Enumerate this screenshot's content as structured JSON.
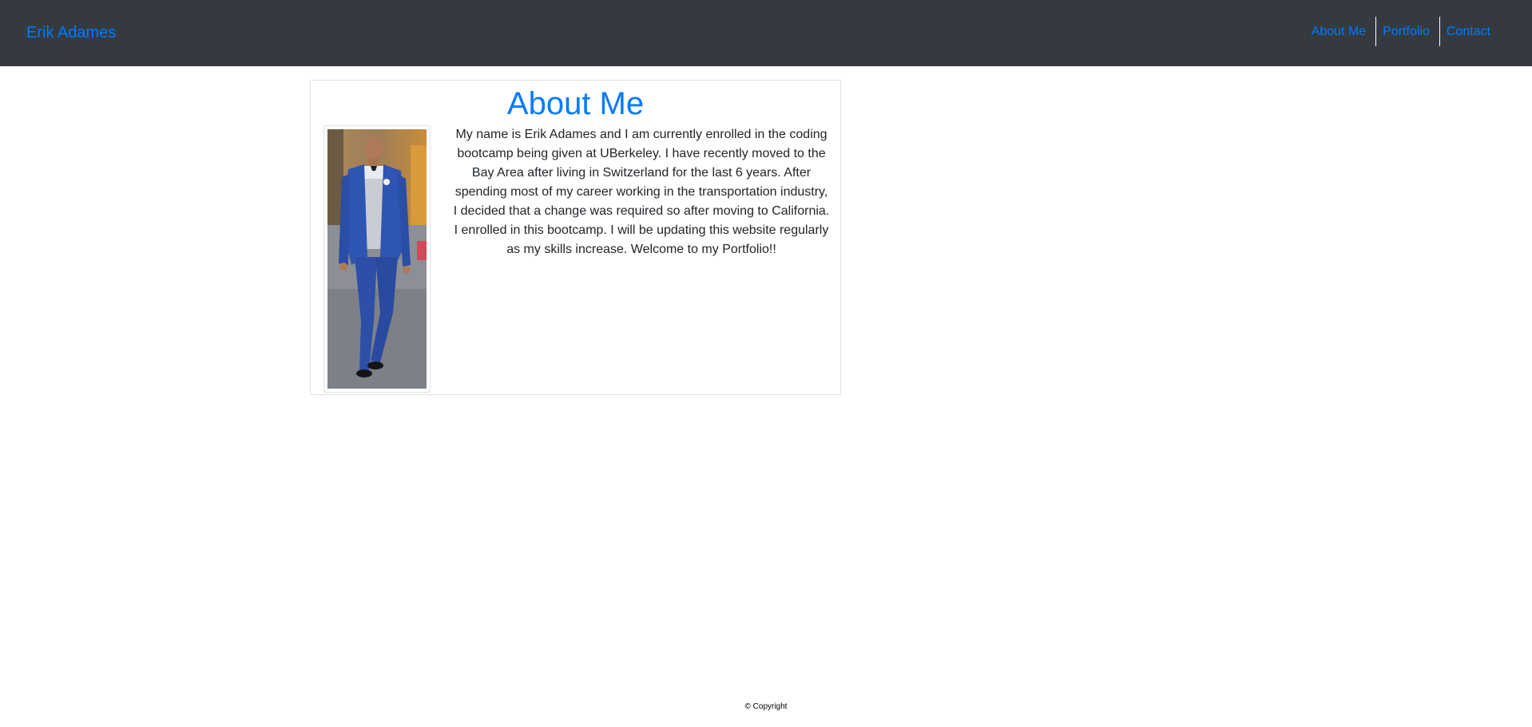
{
  "navbar": {
    "brand": "Erik Adames",
    "links": [
      "About Me",
      "Portfolio",
      "Contact"
    ]
  },
  "about": {
    "title": "About Me",
    "bio": "My name is Erik Adames and I am currently enrolled in the coding bootcamp being given at UBerkeley. I have recently moved to the Bay Area after living in Switzerland for the last 6 years. After spending most of my career working in the transportation industry, I decided that a change was required so after moving to California. I enrolled in this bootcamp. I will be updating this website regularly as my skills increase. Welcome to my Portfolio!!"
  },
  "footer": {
    "copyright": "© Copyright"
  },
  "colors": {
    "navbar_bg": "#343a40",
    "link": "#007bff",
    "text": "#212529"
  }
}
